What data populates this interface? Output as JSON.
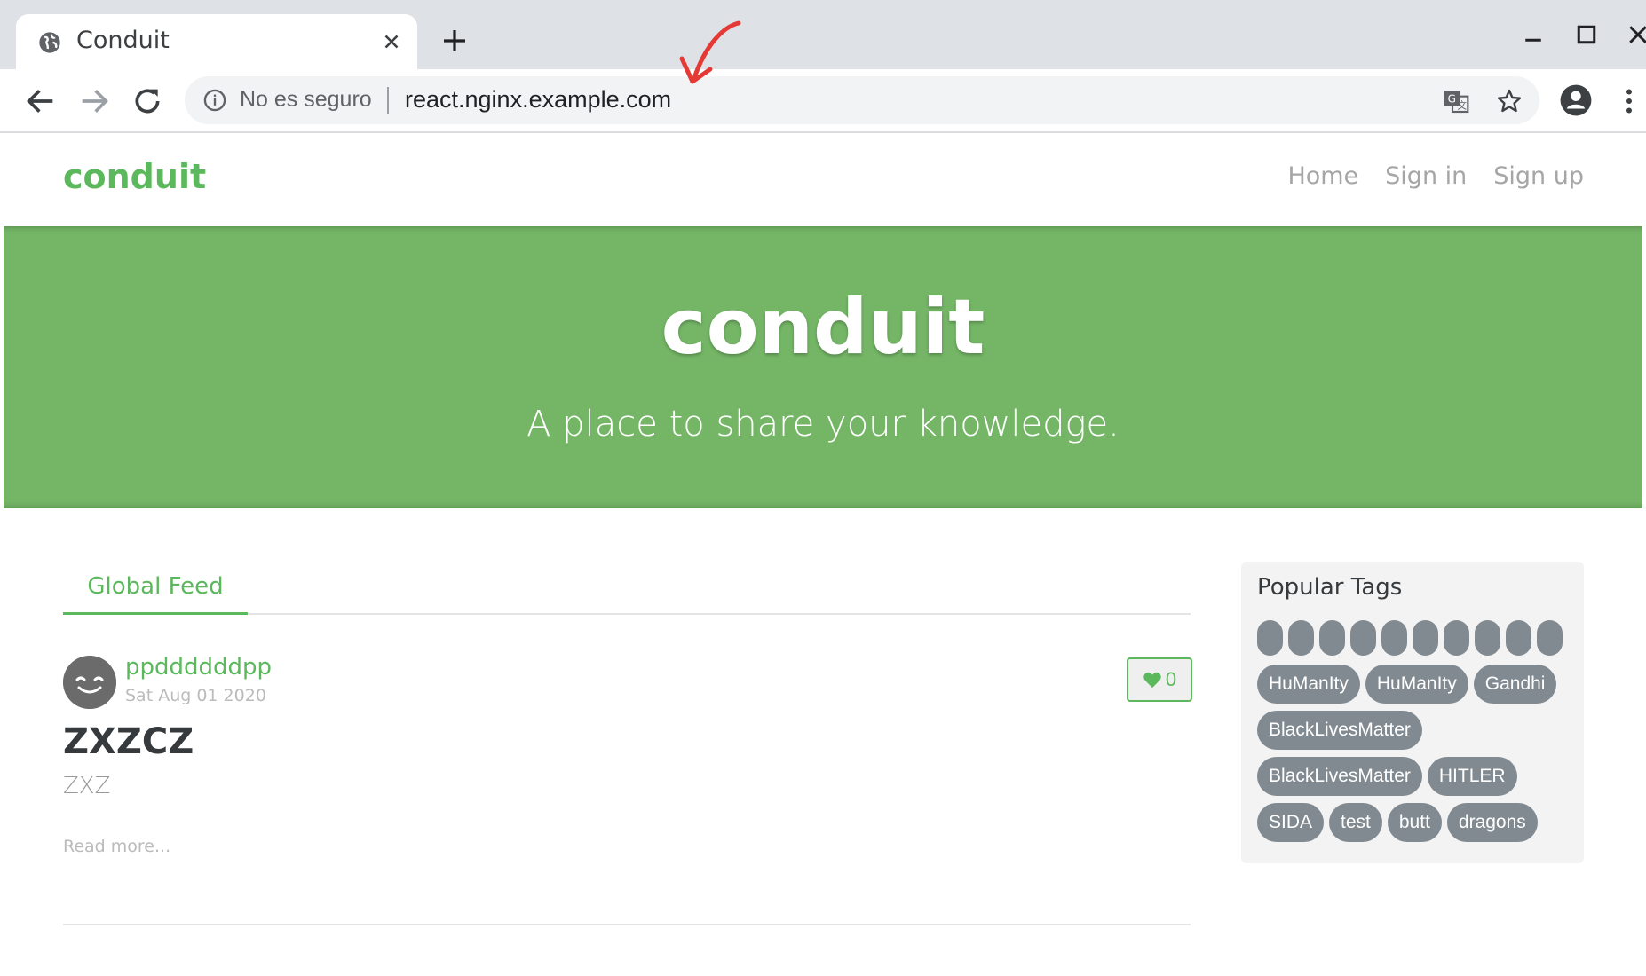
{
  "browser": {
    "tab_title": "Conduit",
    "security_label": "No es seguro",
    "url": "react.nginx.example.com"
  },
  "site": {
    "brand": "conduit",
    "nav": [
      "Home",
      "Sign in",
      "Sign up"
    ]
  },
  "banner": {
    "title": "conduit",
    "subtitle": "A place to share your knowledge."
  },
  "feed": {
    "tabs": [
      "Global Feed"
    ],
    "articles": [
      {
        "author": "ppddddddpp",
        "date": "Sat Aug 01 2020",
        "favorites": "0",
        "title": "ZXZCZ",
        "description": "ZXZ",
        "read_more": "Read more..."
      }
    ]
  },
  "sidebar": {
    "title": "Popular Tags",
    "blank_tag_count": 10,
    "tags": [
      "HuManIty",
      "HuManIty",
      "Gandhi",
      "BlackLivesMatter",
      "BlackLivesMatter",
      "HITLER",
      "SIDA",
      "test",
      "butt",
      "dragons"
    ]
  },
  "colors": {
    "brand_green": "#5cb85c",
    "banner_green": "#74b566",
    "tag_gray": "#818a91",
    "annotation_red": "#e53935"
  },
  "icons": [
    "globe-icon",
    "close-icon",
    "new-tab-icon",
    "back-icon",
    "forward-icon",
    "reload-icon",
    "info-icon",
    "translate-icon",
    "star-icon",
    "profile-icon",
    "menu-icon",
    "heart-icon",
    "smiley-avatar-icon"
  ]
}
